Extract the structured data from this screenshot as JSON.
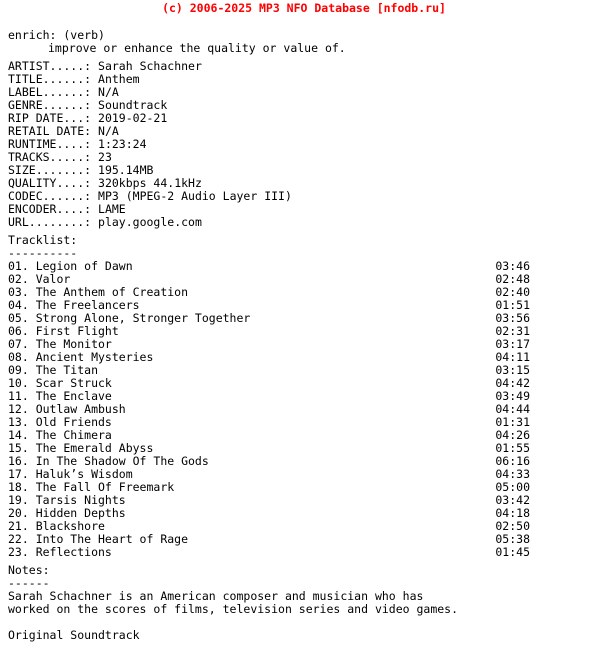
{
  "header": {
    "copyright": "(c) 2006-2025 MP3 NFO Database [nfodb.ru]",
    "color": "#ff0000"
  },
  "definition": {
    "term": "enrich: (verb)",
    "body": "improve or enhance the quality or value of."
  },
  "metadata": [
    {
      "label": "ARTIST.....:",
      "value": "Sarah Schachner"
    },
    {
      "label": "TITLE......:",
      "value": "Anthem"
    },
    {
      "label": "LABEL......:",
      "value": "N/A"
    },
    {
      "label": "GENRE......:",
      "value": "Soundtrack"
    },
    {
      "label": "RIP DATE...:",
      "value": "2019-02-21"
    },
    {
      "label": "RETAIL DATE:",
      "value": "N/A"
    },
    {
      "label": "RUNTIME....:",
      "value": "1:23:24"
    },
    {
      "label": "TRACKS.....:",
      "value": "23"
    },
    {
      "label": "SIZE.......:",
      "value": "195.14MB"
    },
    {
      "label": "QUALITY....:",
      "value": "320kbps 44.1kHz"
    },
    {
      "label": "CODEC......:",
      "value": "MP3 (MPEG-2 Audio Layer III)"
    },
    {
      "label": "ENCODER....:",
      "value": "LAME"
    },
    {
      "label": "URL........:",
      "value": "play.google.com"
    }
  ],
  "tracklist": {
    "title": "Tracklist:",
    "rule": "----------",
    "tracks": [
      {
        "num": "01.",
        "title": "Legion of Dawn",
        "time": "03:46"
      },
      {
        "num": "02.",
        "title": "Valor",
        "time": "02:48"
      },
      {
        "num": "03.",
        "title": "The Anthem of Creation",
        "time": "02:40"
      },
      {
        "num": "04.",
        "title": "The Freelancers",
        "time": "01:51"
      },
      {
        "num": "05.",
        "title": "Strong Alone, Stronger Together",
        "time": "03:56"
      },
      {
        "num": "06.",
        "title": "First Flight",
        "time": "02:31"
      },
      {
        "num": "07.",
        "title": "The Monitor",
        "time": "03:17"
      },
      {
        "num": "08.",
        "title": "Ancient Mysteries",
        "time": "04:11"
      },
      {
        "num": "09.",
        "title": "The Titan",
        "time": "03:15"
      },
      {
        "num": "10.",
        "title": "Scar Struck",
        "time": "04:42"
      },
      {
        "num": "11.",
        "title": "The Enclave",
        "time": "03:49"
      },
      {
        "num": "12.",
        "title": "Outlaw Ambush",
        "time": "04:44"
      },
      {
        "num": "13.",
        "title": "Old Friends",
        "time": "01:31"
      },
      {
        "num": "14.",
        "title": "The Chimera",
        "time": "04:26"
      },
      {
        "num": "15.",
        "title": "The Emerald Abyss",
        "time": "01:55"
      },
      {
        "num": "16.",
        "title": "In The Shadow Of The Gods",
        "time": "06:16"
      },
      {
        "num": "17.",
        "title": "Haluk’s Wisdom",
        "time": "04:33"
      },
      {
        "num": "18.",
        "title": "The Fall Of Freemark",
        "time": "05:00"
      },
      {
        "num": "19.",
        "title": "Tarsis Nights",
        "time": "03:42"
      },
      {
        "num": "20.",
        "title": "Hidden Depths",
        "time": "04:18"
      },
      {
        "num": "21.",
        "title": "Blackshore",
        "time": "02:50"
      },
      {
        "num": "22.",
        "title": "Into The Heart of Rage",
        "time": "05:38"
      },
      {
        "num": "23.",
        "title": "Reflections",
        "time": "01:45"
      }
    ]
  },
  "notes": {
    "title": "Notes:",
    "rule": "------",
    "lines": [
      "Sarah Schachner is an American composer and musician who has",
      "worked on the scores of films, television series and video games."
    ],
    "extra": "Original Soundtrack"
  }
}
